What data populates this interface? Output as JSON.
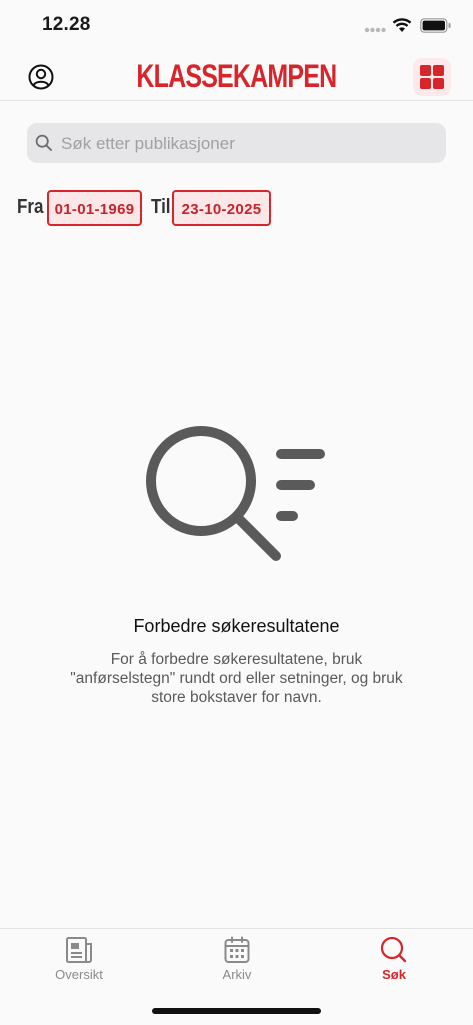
{
  "status": {
    "time": "12.28"
  },
  "header": {
    "logo": "KLASSEKAMPEN"
  },
  "search": {
    "placeholder": "Søk etter publikasjoner"
  },
  "dates": {
    "from_label": "Fra",
    "from_value": "01-01-1969",
    "to_label": "Til",
    "to_value": "23-10-2025"
  },
  "empty_state": {
    "title": "Forbedre søkeresultatene",
    "text": "For å forbedre søkeresultatene, bruk \"anførselstegn\" rundt ord eller setninger, og bruk store bokstaver for navn."
  },
  "tabs": [
    {
      "label": "Oversikt",
      "icon": "newspaper-icon",
      "active": false
    },
    {
      "label": "Arkiv",
      "icon": "calendar-icon",
      "active": false
    },
    {
      "label": "Søk",
      "icon": "search-icon",
      "active": true
    }
  ],
  "colors": {
    "accent": "#d7262b",
    "accent_bg": "#fbe7e7",
    "icon_gray": "#5a5a5a"
  }
}
